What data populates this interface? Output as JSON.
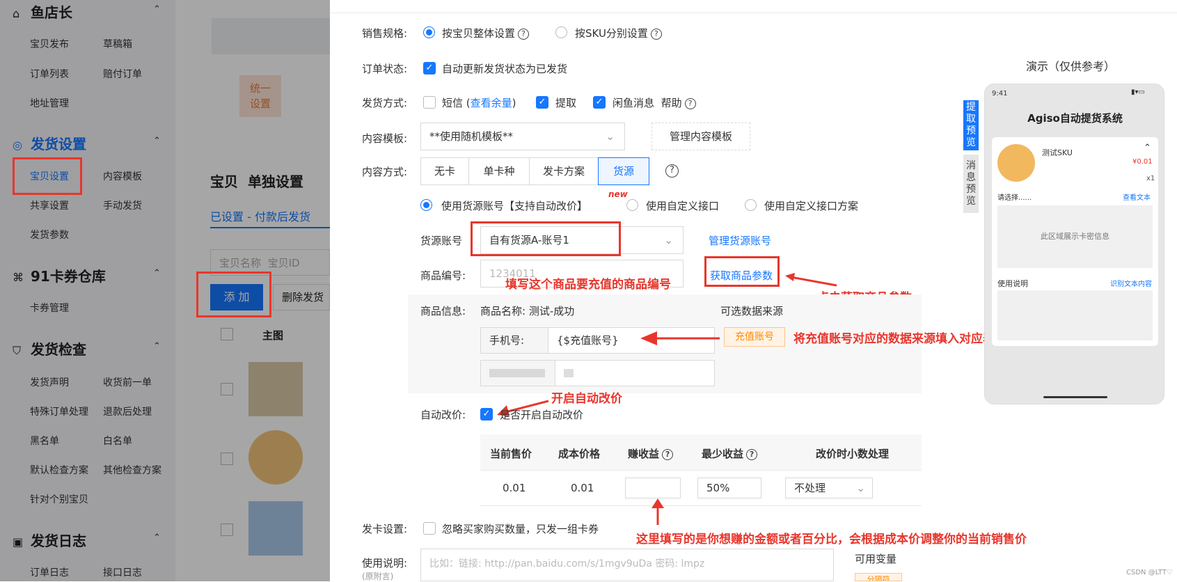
{
  "sidebar": {
    "sections": [
      {
        "title": "鱼店长",
        "icon": "shop-icon",
        "items": [
          "宝贝发布",
          "草稿箱",
          "订单列表",
          "赔付订单",
          "地址管理"
        ]
      },
      {
        "title": "发货设置",
        "icon": "gear-icon",
        "items": [
          "宝贝设置",
          "内容模板",
          "共享设置",
          "手动发货",
          "发货参数"
        ]
      },
      {
        "title": "91卡券仓库",
        "icon": "grid-icon",
        "items": [
          "卡券管理"
        ]
      },
      {
        "title": "发货检查",
        "icon": "shield-icon",
        "items": [
          "发货声明",
          "收货前一单",
          "特殊订单处理",
          "退款后处理",
          "黑名单",
          "白名单",
          "默认检查方案",
          "其他检查方案",
          "针对个别宝贝"
        ]
      },
      {
        "title": "发货日志",
        "icon": "log-icon",
        "items": [
          "订单日志",
          "接口日志"
        ]
      }
    ]
  },
  "middle": {
    "unify_btn": "统一\n设置",
    "heading_main": "宝贝",
    "heading_sub": "单独设置",
    "tab_active": "已设置 - 付款后发货",
    "search_placeholder_1": "宝贝名称",
    "search_placeholder_2": "宝贝ID",
    "add_btn": "添 加",
    "delete_btn": "删除发货",
    "col_main_image": "主图"
  },
  "form": {
    "sales_spec_label": "销售规格:",
    "sales_spec_opt1": "按宝贝整体设置",
    "sales_spec_opt2": "按SKU分别设置",
    "order_status_label": "订单状态:",
    "order_status_opt": "自动更新发货状态为已发货",
    "ship_method_label": "发货方式:",
    "ship_sms": "短信",
    "ship_sms_link": "查看余量",
    "ship_pickup": "提取",
    "ship_xianyu": "闲鱼消息",
    "ship_help": "帮助",
    "content_template_label": "内容模板:",
    "content_template_value": "**使用随机模板**",
    "manage_template_btn": "管理内容模板",
    "content_method_label": "内容方式:",
    "content_methods": [
      "无卡",
      "单卡种",
      "发卡方案",
      "货源"
    ],
    "source_opt1": "使用货源账号【支持自动改价】",
    "new_badge": "new",
    "source_opt2": "使用自定义接口",
    "source_opt3": "使用自定义接口方案",
    "source_account_label": "货源账号",
    "source_account_value": "自有货源A-账号1",
    "manage_source_link": "管理货源账号",
    "product_no_label": "商品编号:",
    "product_no_value": "1234011",
    "get_params_btn": "获取商品参数",
    "product_info_label": "商品信息:",
    "product_name": "商品名称: 测试-成功",
    "optional_source": "可选数据来源",
    "phone_label": "手机号:",
    "phone_value": "{$充值账号}",
    "recharge_tag": "充值账号",
    "auto_price_label": "自动改价:",
    "auto_price_opt": "是否开启自动改价",
    "table_headers": [
      "当前售价",
      "成本价格",
      "赚收益",
      "最少收益",
      "改价时小数处理"
    ],
    "table_row": [
      "0.01",
      "0.01",
      "",
      "50%",
      "不处理"
    ],
    "card_setting_label": "发卡设置:",
    "card_setting_opt": "忽略买家购买数量，只发一组卡券",
    "usage_label": "使用说明:",
    "usage_sub": "(原附言)",
    "usage_placeholder": "比如：链接: http://pan.baidu.com/s/1mgv9uDa 密码: lmpz",
    "available_vars": "可用变量",
    "var_tag": "分隔符"
  },
  "annotations": {
    "fill_product_no": "填写这个商品要充值的商品编号",
    "click_get_params": "点击获取商品参数",
    "fill_source": "将充值账号对应的数据来源填入对应表格",
    "enable_auto_price": "开启自动改价",
    "fill_profit": "这里填写的是你想赚的金额或者百分比，会根据成本价调整你的当前销售价"
  },
  "preview": {
    "title": "演示（仅供参考）",
    "tab1": "提取预览",
    "tab2": "消息预览",
    "time": "9:41",
    "app_title": "Agiso自动提货系统",
    "sku": "测试SKU",
    "price": "¥0.01",
    "qty": "x1",
    "choose": "请选择......",
    "view_text": "查看文本",
    "placeholder": "此区域展示卡密信息",
    "usage": "使用说明",
    "recognize": "识别文本内容"
  },
  "watermark": "CSDN @LTT♡",
  "colors": {
    "accent": "#1677ff",
    "annotation": "#e8362c",
    "tag": "#ff8a00"
  }
}
